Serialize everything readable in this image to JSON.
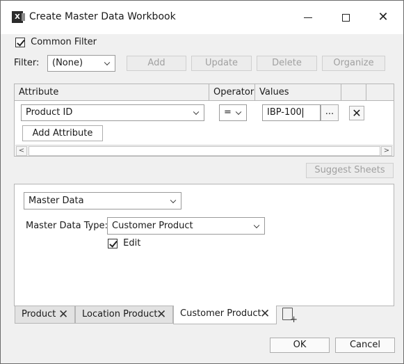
{
  "window": {
    "title": "Create Master Data Workbook",
    "app_icon_letter": "X"
  },
  "common_filter": {
    "label": "Common Filter",
    "checked": true
  },
  "filter": {
    "label": "Filter:",
    "selected": "(None)",
    "buttons": [
      "Add",
      "Update",
      "Delete",
      "Organize"
    ]
  },
  "grid": {
    "headers": [
      "Attribute",
      "Operator",
      "Values"
    ],
    "row": {
      "attribute": "Product ID",
      "operator": "=",
      "value": "IBP-100",
      "ellipsis": "..."
    },
    "add_attribute_label": "Add Attribute"
  },
  "suggest_sheets_label": "Suggest Sheets",
  "panel": {
    "type_combo": "Master Data",
    "master_data_type_label": "Master Data Type:",
    "master_data_type_value": "Customer Product",
    "edit_label": "Edit",
    "edit_checked": true
  },
  "tabs": [
    {
      "label": "Product"
    },
    {
      "label": "Location Product"
    },
    {
      "label": "Customer Product"
    }
  ],
  "footer": {
    "ok_label": "OK",
    "cancel_label": "Cancel"
  }
}
